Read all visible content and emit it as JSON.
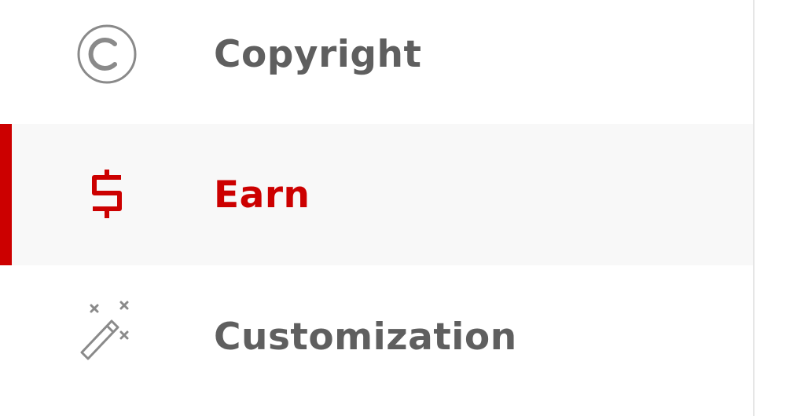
{
  "theme": {
    "accent": "#cc0000",
    "text": "#5f5f5f",
    "icon": "#8a8a8a",
    "active_bg": "#f8f8f8",
    "divider": "#e6e6e6"
  },
  "nav": {
    "items": [
      {
        "label": "Copyright",
        "icon": "copyright-icon",
        "active": false
      },
      {
        "label": "Earn",
        "icon": "dollar-icon",
        "active": true
      },
      {
        "label": "Customization",
        "icon": "magic-wand-icon",
        "active": false
      }
    ]
  }
}
